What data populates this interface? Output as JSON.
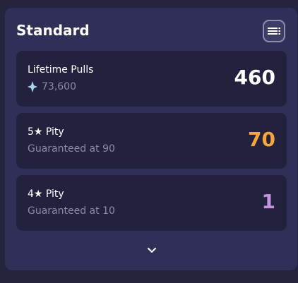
{
  "section": {
    "title": "Standard",
    "menu_icon": "list-icon"
  },
  "stats": [
    {
      "label": "Lifetime Pulls",
      "sub": "73,600",
      "sub_icon": "gem-icon",
      "value": "460",
      "value_color": "#ffffff"
    },
    {
      "label": "5★ Pity",
      "sub": "Guaranteed at 90",
      "value": "70",
      "value_color": "#f5a73c"
    },
    {
      "label": "4★ Pity",
      "sub": "Guaranteed at 10",
      "value": "1",
      "value_color": "#c792e0"
    }
  ],
  "expand_icon": "chevron-down-icon"
}
